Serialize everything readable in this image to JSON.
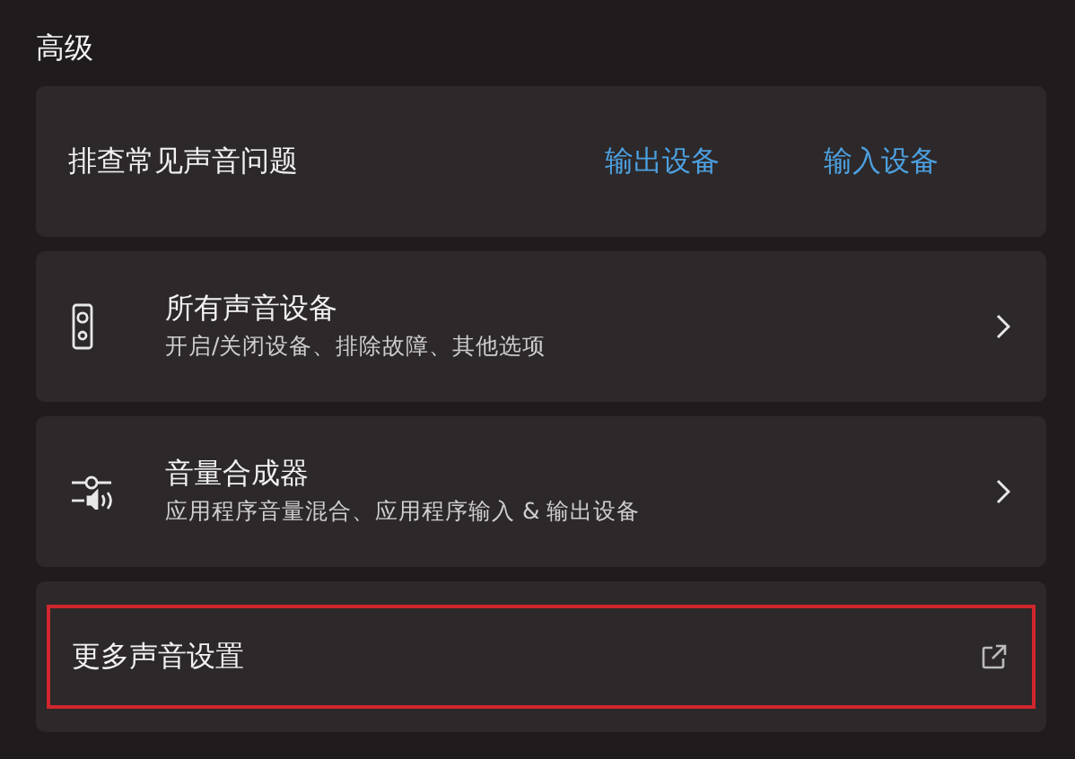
{
  "section_title": "高级",
  "cards": [
    {
      "kind": "troubleshoot",
      "title": "排查常见声音问题",
      "links": [
        "输出设备",
        "输入设备"
      ]
    },
    {
      "kind": "devices",
      "title": "所有声音设备",
      "subtitle": "开启/关闭设备、排除故障、其他选项"
    },
    {
      "kind": "mixer",
      "title": "音量合成器",
      "subtitle": "应用程序音量混合、应用程序输入 & 输出设备"
    },
    {
      "kind": "external",
      "title": "更多声音设置",
      "highlighted": true
    }
  ]
}
